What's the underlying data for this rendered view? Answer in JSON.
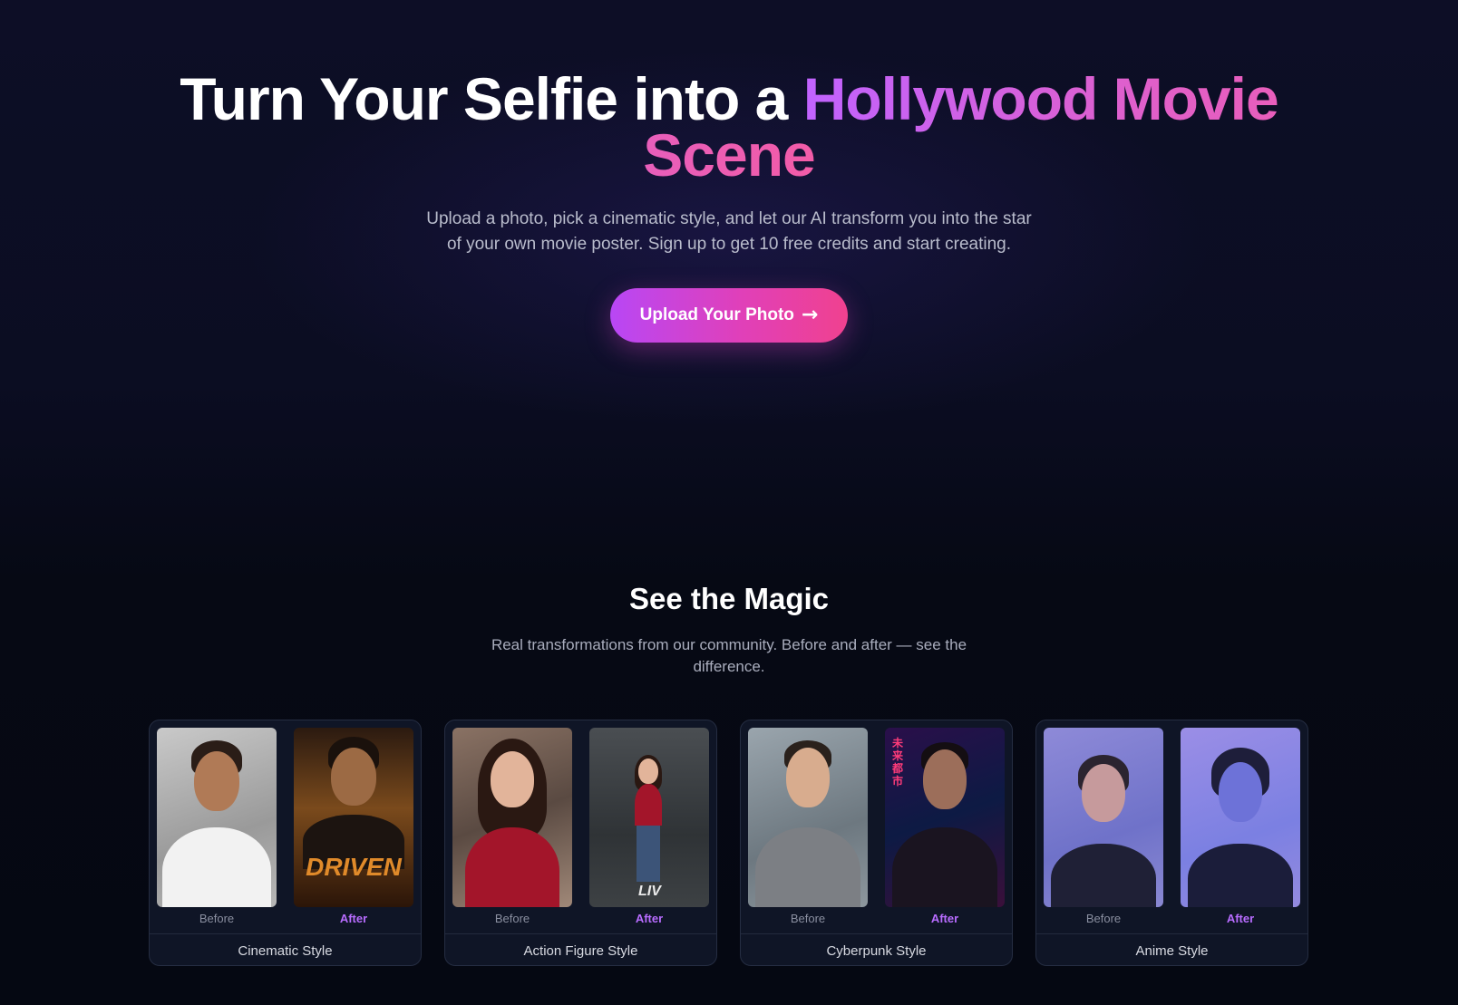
{
  "hero": {
    "title_white": "Turn Your Selfie into a",
    "title_gradient": "Hollywood Movie Scene",
    "subtitle": "Upload a photo, pick a cinematic style, and let our AI transform you into the star of your own movie poster. Sign up to get 10 free credits and start creating.",
    "cta_label": "Upload Your Photo",
    "cta_icon": "arrow-right-icon"
  },
  "magic": {
    "title": "See the Magic",
    "subtitle": "Real transformations from our community. Before and after — see the difference."
  },
  "cards": [
    {
      "before_label": "Before",
      "after_label": "After",
      "style": "Cinematic Style",
      "poster_text": "DRIVEN"
    },
    {
      "before_label": "Before",
      "after_label": "After",
      "style": "Action Figure Style",
      "poster_text": "LIV"
    },
    {
      "before_label": "Before",
      "after_label": "After",
      "style": "Cyberpunk Style",
      "poster_text": "未来都市"
    },
    {
      "before_label": "Before",
      "after_label": "After",
      "style": "Anime Style",
      "poster_text": ""
    }
  ],
  "colors": {
    "accent_purple": "#c163ff",
    "accent_pink": "#f25ca8",
    "background": "#070a16"
  }
}
